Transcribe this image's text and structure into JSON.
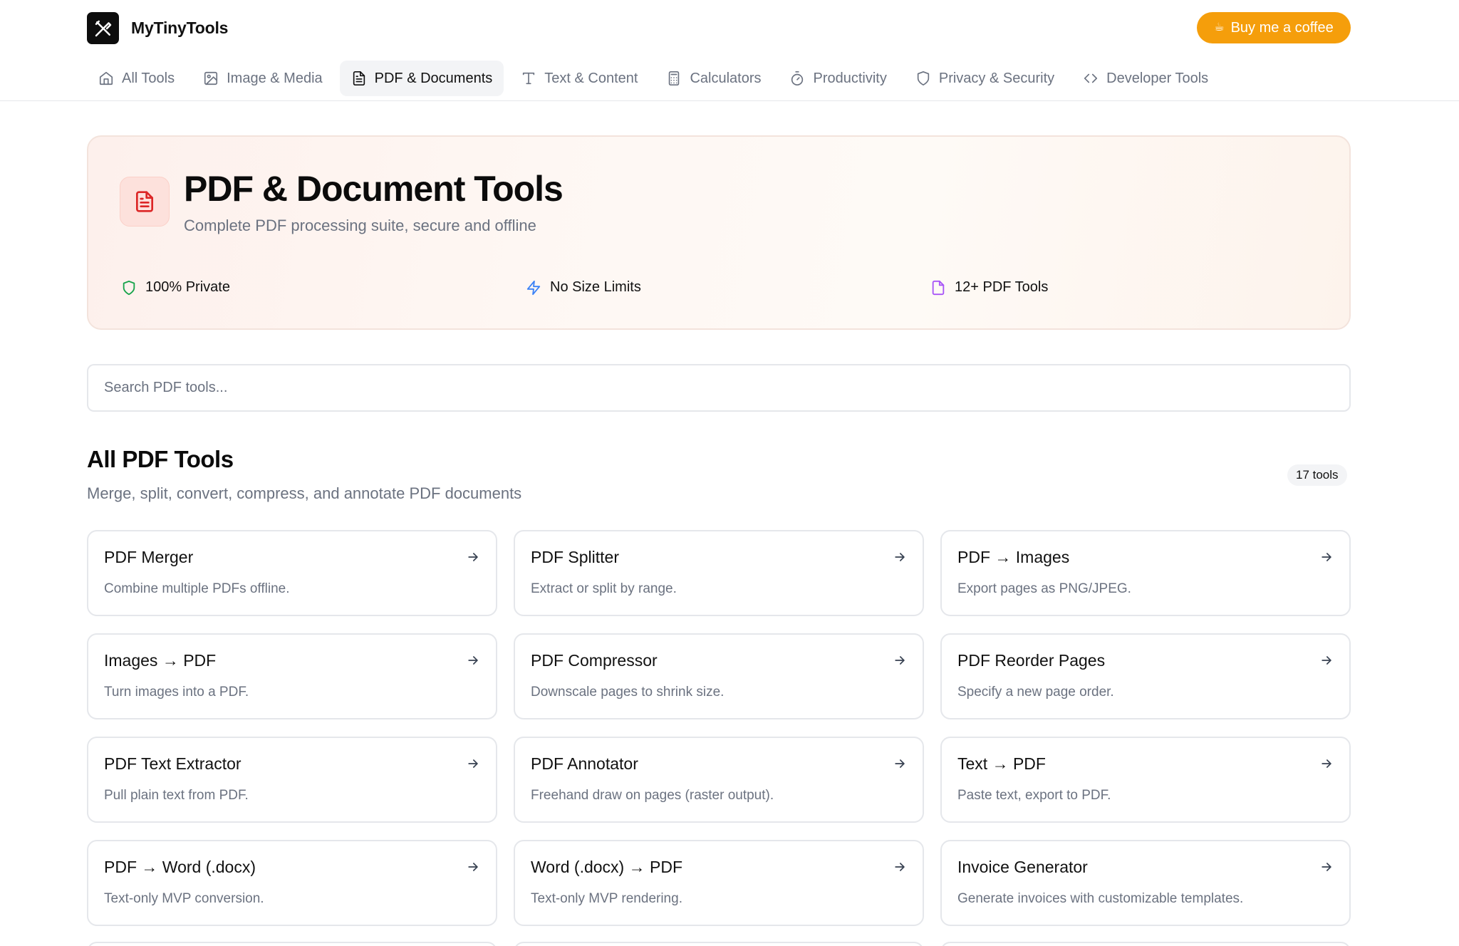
{
  "brand": {
    "name": "MyTinyTools"
  },
  "coffee": {
    "icon": "coffee-cup-icon",
    "label": "Buy me a coffee"
  },
  "nav": [
    {
      "label": "All Tools",
      "icon": "home-icon",
      "active": false
    },
    {
      "label": "Image & Media",
      "icon": "image-icon",
      "active": false
    },
    {
      "label": "PDF & Documents",
      "icon": "document-icon",
      "active": true
    },
    {
      "label": "Text & Content",
      "icon": "text-icon",
      "active": false
    },
    {
      "label": "Calculators",
      "icon": "calculator-icon",
      "active": false
    },
    {
      "label": "Productivity",
      "icon": "timer-icon",
      "active": false
    },
    {
      "label": "Privacy & Security",
      "icon": "shield-icon",
      "active": false
    },
    {
      "label": "Developer Tools",
      "icon": "code-icon",
      "active": false
    }
  ],
  "hero": {
    "title": "PDF & Document Tools",
    "subtitle": "Complete PDF processing suite, secure and offline",
    "features": [
      {
        "label": "100% Private",
        "icon": "shield-icon",
        "color": "#16a34a"
      },
      {
        "label": "No Size Limits",
        "icon": "lightning-icon",
        "color": "#3b82f6"
      },
      {
        "label": "12+ PDF Tools",
        "icon": "file-icon",
        "color": "#a855f7"
      }
    ]
  },
  "search": {
    "placeholder": "Search PDF tools..."
  },
  "section": {
    "title": "All PDF Tools",
    "subtitle": "Merge, split, convert, compress, and annotate PDF documents",
    "count": "17 tools"
  },
  "tools": [
    {
      "title": "PDF Merger",
      "desc": "Combine multiple PDFs offline."
    },
    {
      "title": "PDF Splitter",
      "desc": "Extract or split by range."
    },
    {
      "title": "PDF → Images",
      "desc": "Export pages as PNG/JPEG."
    },
    {
      "title": "Images → PDF",
      "desc": "Turn images into a PDF."
    },
    {
      "title": "PDF Compressor",
      "desc": "Downscale pages to shrink size."
    },
    {
      "title": "PDF Reorder Pages",
      "desc": "Specify a new page order."
    },
    {
      "title": "PDF Text Extractor",
      "desc": "Pull plain text from PDF."
    },
    {
      "title": "PDF Annotator",
      "desc": "Freehand draw on pages (raster output)."
    },
    {
      "title": "Text → PDF",
      "desc": "Paste text, export to PDF."
    },
    {
      "title": "PDF → Word (.docx)",
      "desc": "Text-only MVP conversion."
    },
    {
      "title": "Word (.docx) → PDF",
      "desc": "Text-only MVP rendering."
    },
    {
      "title": "Invoice Generator",
      "desc": "Generate invoices with customizable templates."
    }
  ],
  "colors": {
    "accent": "#f59e0b",
    "pdf_red": "#dc2626"
  }
}
